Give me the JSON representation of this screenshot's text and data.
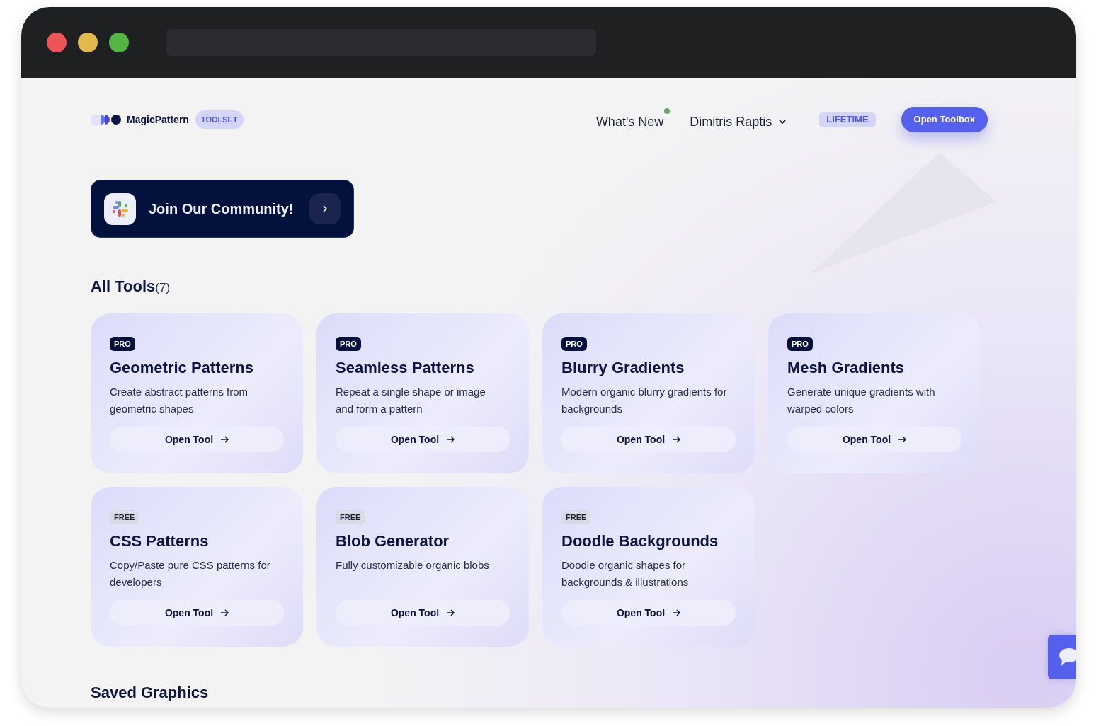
{
  "header": {
    "brand": "MagicPattern",
    "brand_badge": "TOOLSET",
    "nav": [
      {
        "label": "What's New",
        "kind": "news",
        "unread": true
      },
      {
        "label": "Dimitris Raptis",
        "kind": "account"
      }
    ],
    "plan_badge": "LIFETIME",
    "cta": "Open Toolbox"
  },
  "community": {
    "label": "Join Our Community!"
  },
  "all_tools": {
    "title": "All Tools",
    "count": "(7)",
    "tools": [
      {
        "tier": "PRO",
        "kind": "pro",
        "name": "Geometric Patterns",
        "description": "Create abstract patterns from geometric shapes",
        "action": "Open Tool"
      },
      {
        "tier": "PRO",
        "kind": "pro",
        "name": "Seamless Patterns",
        "description": "Repeat a single shape or image and form a pattern",
        "action": "Open Tool"
      },
      {
        "tier": "PRO",
        "kind": "pro",
        "name": "Blurry Gradients",
        "description": "Modern organic blurry gradients for backgrounds",
        "action": "Open Tool"
      },
      {
        "tier": "PRO",
        "kind": "pro",
        "name": "Mesh Gradients",
        "description": "Generate unique gradients with warped colors",
        "action": "Open Tool"
      },
      {
        "tier": "FREE",
        "kind": "free",
        "name": "CSS Patterns",
        "description": "Copy/Paste pure CSS patterns for developers",
        "action": "Open Tool"
      },
      {
        "tier": "FREE",
        "kind": "free",
        "name": "Blob Generator",
        "description": "Fully customizable organic blobs",
        "action": "Open Tool"
      },
      {
        "tier": "FREE",
        "kind": "free",
        "name": "Doodle Backgrounds",
        "description": "Doodle organic shapes for backgrounds & illustrations",
        "action": "Open Tool"
      }
    ]
  },
  "saved": {
    "title": "Saved Graphics"
  }
}
